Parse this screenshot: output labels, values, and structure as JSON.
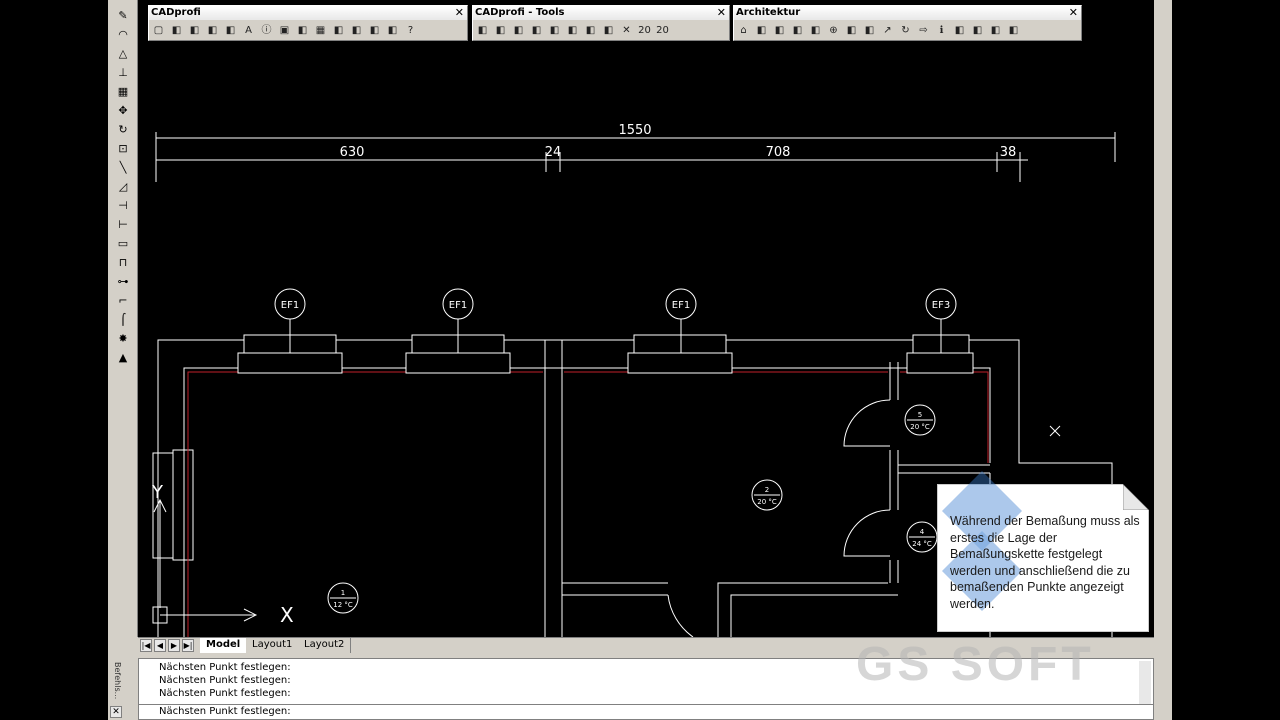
{
  "toolbars": [
    {
      "title": "CADprofi",
      "icons": [
        "new-file-icon",
        "open-icon",
        "layers-icon",
        "table-icon",
        "chart-icon",
        "text-a-icon",
        "info-icon",
        "save-icon",
        "sort-icon",
        "grid-icon",
        "eraser-icon",
        "link-icon",
        "print-icon",
        "window-icon",
        "help-icon"
      ]
    },
    {
      "title": "CADprofi - Tools",
      "icons": [
        "pipe-icon",
        "pipe-join-icon",
        "pipe-split-icon",
        "draw-icon",
        "pen-icon",
        "elbow-icon",
        "tree-icon",
        "duplicate-icon",
        "wrench-icon",
        "number-20-icon",
        "number-20b-icon"
      ]
    },
    {
      "title": "Architektur",
      "icons": [
        "house-icon",
        "wall-icon",
        "window-frame-icon",
        "stairs-icon",
        "furniture-icon",
        "compass-icon",
        "north-icon",
        "tree-icon",
        "arrow-icon",
        "rotate-icon",
        "arrow-right-icon",
        "info-box-icon",
        "arrow-turn-icon",
        "level-icon",
        "dimension-icon",
        "measure-icon"
      ]
    }
  ],
  "left_tools": [
    "pencil-icon",
    "circle-arc-icon",
    "triangle-icon",
    "stamp-icon",
    "grid-icon",
    "move-icon",
    "rotate-icon",
    "scale-icon",
    "line-icon",
    "trim-icon",
    "break-icon",
    "extend-icon",
    "rectangle-icon",
    "polygon-icon",
    "join-icon",
    "fillet-icon",
    "chamfer-icon",
    "explode-icon",
    "hatch-icon"
  ],
  "dimensions": {
    "total": "1550",
    "seg1": "630",
    "seg2": "24",
    "seg3": "708",
    "seg4": "38"
  },
  "fixtures": [
    "EF1",
    "EF1",
    "EF1",
    "EF3"
  ],
  "rooms": [
    {
      "number": "1",
      "temp": "12 °C"
    },
    {
      "number": "2",
      "temp": "20 °C"
    },
    {
      "number": "4",
      "temp": "24 °C"
    },
    {
      "number": "5",
      "temp": "20 °C"
    }
  ],
  "ucs": {
    "x_label": "X",
    "y_label": "Y"
  },
  "tabs": {
    "model": "Model",
    "layout1": "Layout1",
    "layout2": "Layout2"
  },
  "command": {
    "label": "Befehls...",
    "history": [
      "Nächsten Punkt festlegen:",
      "Nächsten Punkt festlegen:",
      "Nächsten Punkt festlegen:"
    ],
    "prompt": "Nächsten Punkt festlegen:"
  },
  "tooltip": {
    "text": "Während der Bemaßung muss als erstes die Lage der Bemaßungskette festgelegt werden und anschließend die zu bemaßenden Punkte angezeigt werden."
  },
  "watermark": "GS SOFT",
  "colors": {
    "canvas": "#000000",
    "lines": "#ffffff",
    "inner_wall": "#c0202a",
    "ui": "#d4d0c8",
    "logo_blue": "#3a7fd0"
  }
}
